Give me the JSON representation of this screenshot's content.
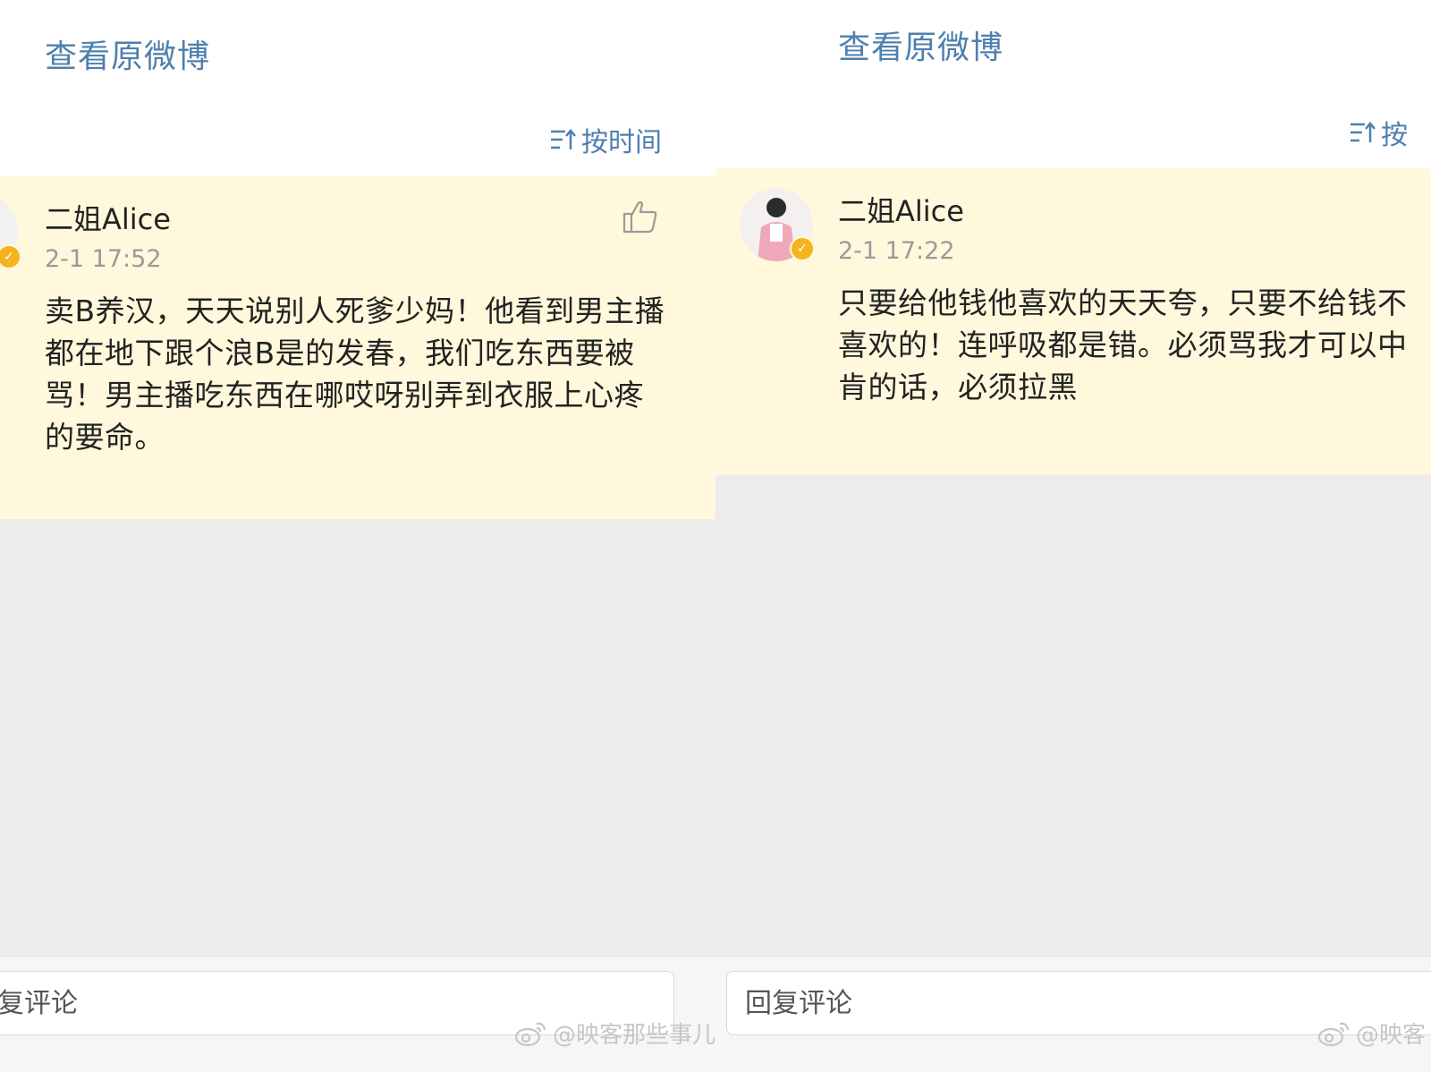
{
  "left_panel": {
    "view_original": "查看原微博",
    "sort_label": "按时间",
    "comment": {
      "username": "二姐Alice",
      "timestamp": "2-1 17:52",
      "text": "卖B养汉，天天说别人死爹少妈！他看到男主播都在地下跟个浪B是的发春，我们吃东西要被骂！男主播吃东西在哪哎呀别弄到衣服上心疼的要命。"
    },
    "reply_placeholder": "复评论",
    "watermark": "@映客那些事儿"
  },
  "right_panel": {
    "view_original": "查看原微博",
    "sort_label": "按",
    "comment": {
      "username": "二姐Alice",
      "timestamp": "2-1 17:22",
      "text": "只要给他钱他喜欢的天天夸，只要不给钱不喜欢的！连呼吸都是错。必须骂我才可以中肯的话，必须拉黑"
    },
    "reply_placeholder": "回复评论",
    "watermark": "@映客"
  },
  "colors": {
    "link_blue": "#4f7fad",
    "comment_highlight": "#fff8dc",
    "empty_gray": "#ececec",
    "verified_badge": "#f5b320"
  },
  "icons": {
    "sort": "sort-time-icon",
    "like": "thumbs-up-icon",
    "verified": "verified-badge-icon",
    "watermark": "weibo-logo-icon"
  }
}
